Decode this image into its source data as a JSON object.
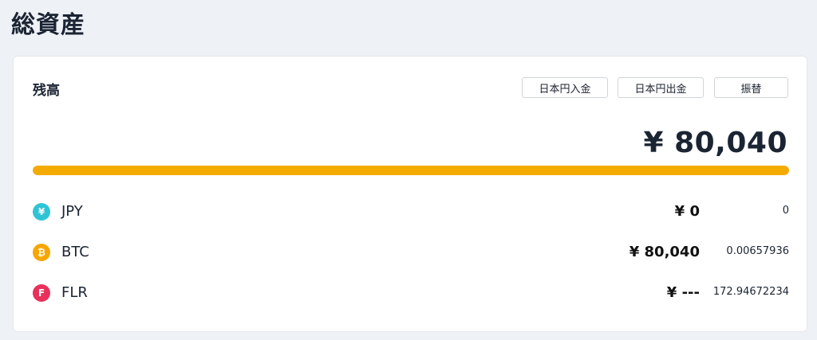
{
  "header": {
    "title": "総資産"
  },
  "balance": {
    "title": "残高",
    "actions": {
      "deposit": "日本円入金",
      "withdraw": "日本円出金",
      "transfer": "振替"
    },
    "total": "¥ 80,040",
    "bar": {
      "fraction": 1.0,
      "color": "#f3ab00"
    }
  },
  "assets": [
    {
      "name": "JPY",
      "icon_glyph": "¥",
      "icon": "yen-icon",
      "icon_color": "#2ec4d6",
      "value": "¥ 0",
      "amount": "0"
    },
    {
      "name": "BTC",
      "icon_glyph": "₿",
      "icon": "bitcoin-icon",
      "icon_color": "#f7a600",
      "value": "¥ 80,040",
      "amount": "0.00657936"
    },
    {
      "name": "FLR",
      "icon_glyph": "F",
      "icon": "flare-icon",
      "icon_color": "#e8305a",
      "value": "¥ ---",
      "amount": "172.94672234"
    }
  ]
}
